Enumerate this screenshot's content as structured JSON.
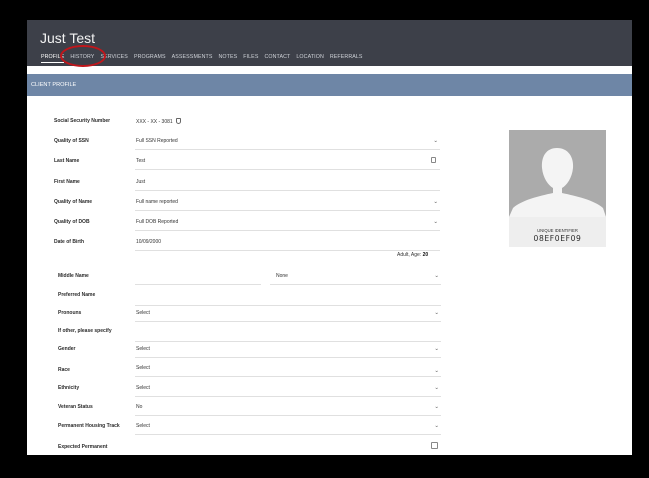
{
  "header": {
    "client_name": "Just Test",
    "tabs": [
      {
        "label": "PROFILE",
        "active": true
      },
      {
        "label": "HISTORY",
        "active": false
      },
      {
        "label": "SERVICES",
        "active": false
      },
      {
        "label": "PROGRAMS",
        "active": false
      },
      {
        "label": "ASSESSMENTS",
        "active": false
      },
      {
        "label": "NOTES",
        "active": false
      },
      {
        "label": "FILES",
        "active": false
      },
      {
        "label": "CONTACT",
        "active": false
      },
      {
        "label": "LOCATION",
        "active": false
      },
      {
        "label": "REFERRALS",
        "active": false
      }
    ]
  },
  "section": {
    "title": "CLIENT PROFILE"
  },
  "form": {
    "ssn": {
      "label": "Social Security Number",
      "value": "XXX - XX - 3081"
    },
    "ssn_quality": {
      "label": "Quality of SSN",
      "value": "Full SSN Reported"
    },
    "last_name": {
      "label": "Last Name",
      "value": "Test"
    },
    "first_name": {
      "label": "First Name",
      "value": "Just"
    },
    "name_quality": {
      "label": "Quality of Name",
      "value": "Full name reported"
    },
    "dob_quality": {
      "label": "Quality of DOB",
      "value": "Full DOB Reported"
    },
    "dob": {
      "label": "Date of Birth",
      "value": "10/09/2000"
    },
    "age": {
      "label": "Adult, Age:",
      "value": "20"
    },
    "middle_name": {
      "label": "Middle Name",
      "value": "",
      "suffix_value": "None"
    },
    "preferred_name": {
      "label": "Preferred Name",
      "value": ""
    },
    "pronouns": {
      "label": "Pronouns",
      "value": "Select"
    },
    "if_other": {
      "label": "If other, please specify",
      "value": ""
    },
    "gender": {
      "label": "Gender",
      "value": "Select"
    },
    "race": {
      "label": "Race",
      "value": "Select"
    },
    "ethnicity": {
      "label": "Ethnicity",
      "value": "Select"
    },
    "veteran": {
      "label": "Veteran Status",
      "value": "No"
    },
    "housing_track": {
      "label": "Permanent Housing Track",
      "value": "Select"
    },
    "expected_permanent": {
      "label": "Expected Permanent",
      "value": ""
    }
  },
  "profile_card": {
    "uid_label": "UNIQUE IDENTIFIER",
    "uid_value": "08EF0EF09"
  }
}
